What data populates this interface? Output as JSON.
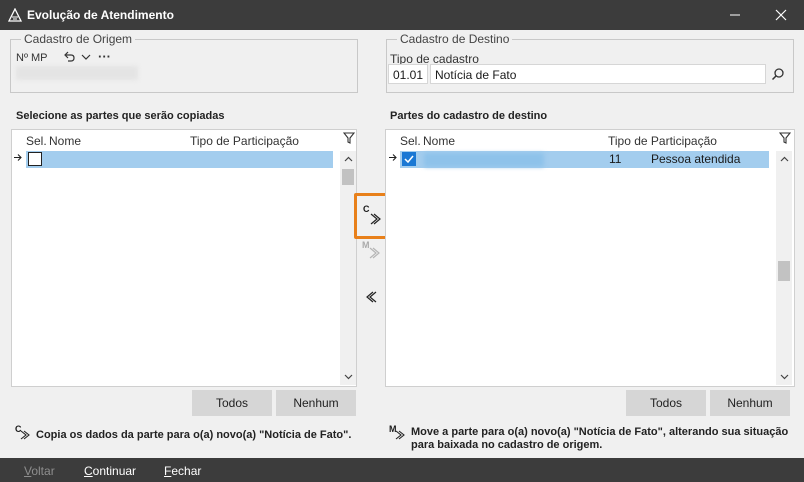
{
  "window": {
    "title": "Evolução de Atendimento"
  },
  "origem": {
    "legend": "Cadastro de Origem",
    "mp_label": "Nº MP",
    "more": "···"
  },
  "destino": {
    "legend": "Cadastro de Destino",
    "tipo_label": "Tipo de cadastro",
    "tipo_code": "01.01",
    "tipo_name": "Notícia de Fato"
  },
  "left_panel": {
    "title": "Selecione as partes que serão copiadas",
    "columns": {
      "sel": "Sel.",
      "nome": "Nome",
      "tipo": "Tipo de Participação"
    },
    "buttons": {
      "all": "Todos",
      "none": "Nenhum"
    }
  },
  "right_panel": {
    "title": "Partes do cadastro de destino",
    "columns": {
      "sel": "Sel.",
      "nome": "Nome",
      "tipo": "Tipo de Participação"
    },
    "rows": [
      {
        "code": "11",
        "participacao": "Pessoa atendida"
      }
    ],
    "buttons": {
      "all": "Todos",
      "none": "Nenhum"
    }
  },
  "move_buttons": {
    "copy_key": "C",
    "move_key": "M"
  },
  "help": {
    "copy_key": "C",
    "copy_text": "Copia os dados da parte para o(a) novo(a) \"Notícia de Fato\".",
    "move_key": "M",
    "move_text_1": "Move a parte para o(a) novo(a) \"Notícia de Fato\", alterando sua situação",
    "move_text_2": "para baixada no cadastro de origem."
  },
  "footer": {
    "voltar_first": "V",
    "voltar_rest": "oltar",
    "continuar_first": "C",
    "continuar_rest": "ontinuar",
    "fechar_first": "F",
    "fechar_rest": "echar"
  },
  "colors": {
    "accent": "#1a78d4",
    "highlight": "#e8801a",
    "selection": "#a3cdee",
    "titlebar": "#3c3c3c"
  }
}
